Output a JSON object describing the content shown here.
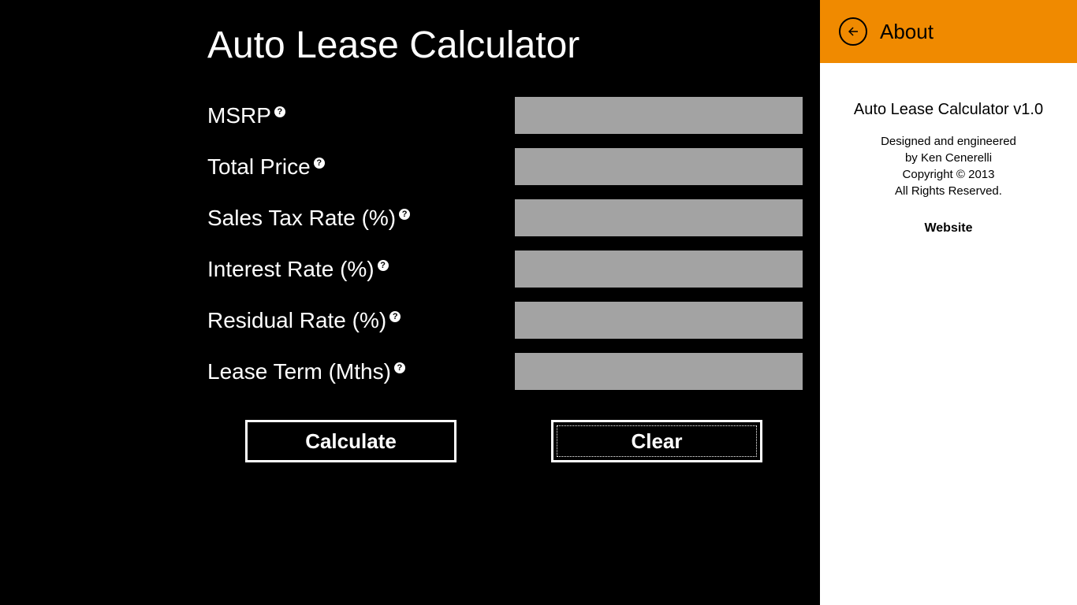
{
  "page": {
    "title": "Auto Lease Calculator"
  },
  "fields": {
    "msrp": {
      "label": "MSRP",
      "help": "?",
      "value": ""
    },
    "total_price": {
      "label": "Total Price",
      "help": "?",
      "value": ""
    },
    "sales_tax": {
      "label": "Sales Tax Rate (%)",
      "help": "?",
      "value": ""
    },
    "interest_rate": {
      "label": "Interest Rate (%)",
      "help": "?",
      "value": ""
    },
    "residual_rate": {
      "label": "Residual Rate (%)",
      "help": "?",
      "value": ""
    },
    "lease_term": {
      "label": "Lease Term (Mths)",
      "help": "?",
      "value": ""
    }
  },
  "buttons": {
    "calculate": "Calculate",
    "clear": "Clear"
  },
  "about": {
    "title": "About",
    "version": "Auto Lease Calculator v1.0",
    "line1": "Designed and engineered",
    "line2": "by Ken Cenerelli",
    "line3": "Copyright © 2013",
    "line4": "All Rights Reserved.",
    "website": "Website"
  }
}
